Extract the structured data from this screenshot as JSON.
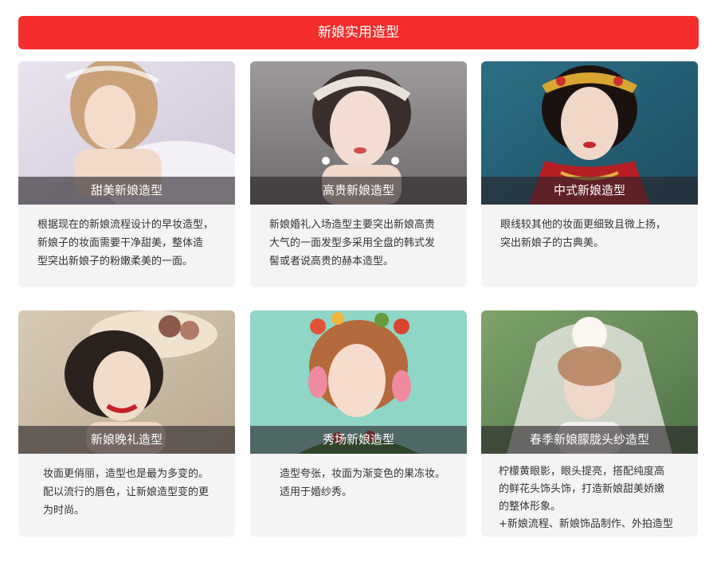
{
  "banner": {
    "title": "新娘实用造型"
  },
  "cards": [
    {
      "title": "甜美新娘造型",
      "lines": [
        "根据现在的新娘流程设计的早妆造型，",
        "新娘子的妆面需要干净甜美，整体造",
        "型突出新娘子的粉嫩柔美的一面。"
      ]
    },
    {
      "title": "高贵新娘造型",
      "lines": [
        "新娘婚礼入场造型主要突出新娘高贵",
        "大气的一面发型多采用全盘的韩式发",
        "髻或者说高贵的赫本造型。"
      ]
    },
    {
      "title": "中式新娘造型",
      "lines": [
        "眼线较其他的妆面更细致且微上扬，",
        "突出新娘子的古典美。"
      ]
    },
    {
      "title": "新娘晚礼造型",
      "lines": [
        "妆面更俏丽，造型也是最为多变的。",
        "配以流行的唇色，让新娘造型变的更",
        "为时尚。"
      ]
    },
    {
      "title": "秀场新娘造型",
      "lines": [
        "造型夸张，妆面为渐变色的果冻妆。",
        "适用于婚纱秀。"
      ]
    },
    {
      "title": "春季新娘朦胧头纱造型",
      "lines": [
        "柠檬黄眼影，眼头提亮，搭配纯度高",
        "的鲜花头饰头饰，打造新娘甜美娇嫩",
        "的整体形象。",
        "+新娘流程、新娘饰品制作、外拍造型"
      ]
    }
  ],
  "colors": {
    "accent": "#f52d2d",
    "card_bg": "#f5f4f5",
    "caption_bg": "#282428"
  }
}
